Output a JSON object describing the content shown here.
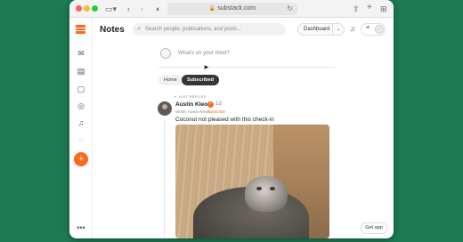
{
  "browser": {
    "address": "substack.com",
    "icons": [
      "sidebar-icon",
      "back-icon",
      "forward-icon",
      "shield-icon",
      "share-icon",
      "new-tab-icon",
      "tabs-overview-icon"
    ]
  },
  "rail": {
    "items": [
      "inbox-icon",
      "library-icon",
      "chat-icon",
      "explore-icon",
      "bell-icon",
      "star-icon",
      "more-icon"
    ],
    "compose_symbol": "+"
  },
  "header": {
    "title": "Notes",
    "search_placeholder": "Search people, publications, and posts...",
    "dashboard_label": "Dashboard"
  },
  "composer": {
    "prompt": "What's on your mind?"
  },
  "tabs": [
    {
      "label": "Home",
      "selected": false
    },
    {
      "label": "Subscribed",
      "selected": true
    }
  ],
  "note": {
    "context": "JUST REPLIED",
    "author": "Austin Kleon",
    "time": "1d",
    "writes": "Writes Austin Kleon",
    "subscribe": "Subscribe",
    "text": "Coconut not pleased with this check-in"
  },
  "footer": {
    "get_app": "Get app"
  },
  "colors": {
    "accent": "#ff6719",
    "background": "#1d7a52"
  }
}
